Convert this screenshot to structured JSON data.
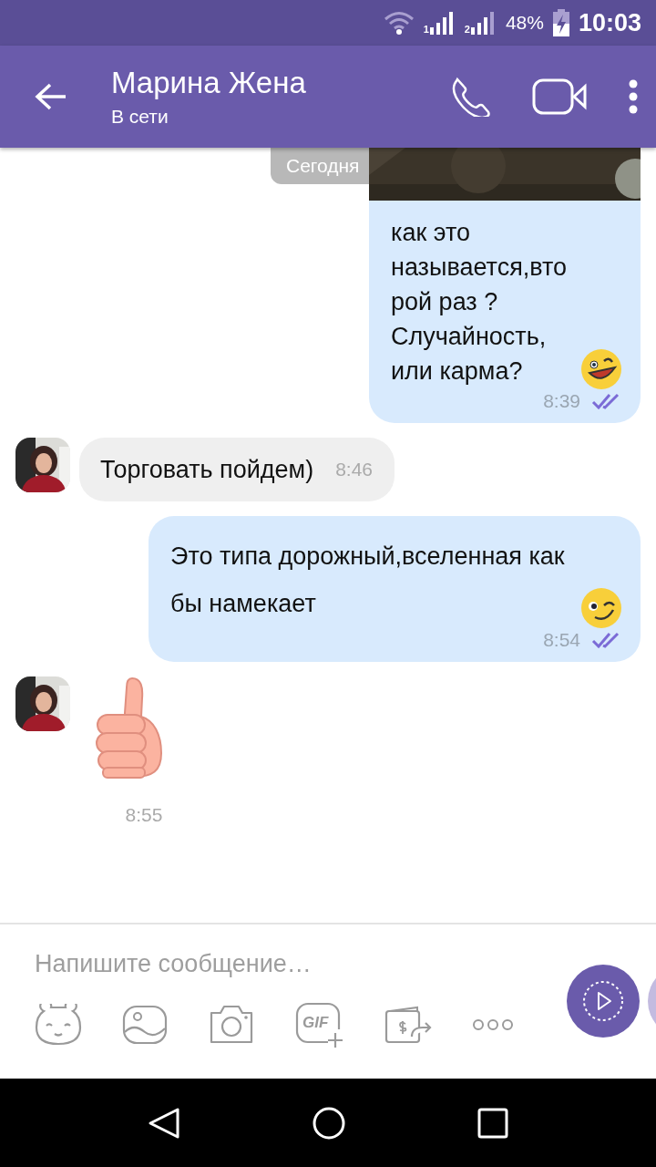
{
  "status_bar": {
    "sims": [
      {
        "label": "1"
      },
      {
        "label": "2"
      }
    ],
    "battery": "48%",
    "time": "10:03"
  },
  "header": {
    "title": "Марина Жена",
    "status": "В сети"
  },
  "date_chip": "Сегодня",
  "messages": [
    {
      "kind": "outgoing",
      "text": "как это называется,второй раз ? Случайность, или карма?",
      "emoji": {
        "kind": "grin"
      },
      "time": "8:39",
      "read": true
    },
    {
      "kind": "incoming",
      "text": "Торговать пойдем)",
      "time": "8:46"
    },
    {
      "kind": "outgoing",
      "text": "Это типа дорожный,вселенная как бы намекает",
      "emoji": {
        "kind": "wink"
      },
      "time": "8:54",
      "read": true
    },
    {
      "kind": "sticker",
      "time": "8:55"
    }
  ],
  "composer": {
    "placeholder": "Напишите сообщение…",
    "gif_label": "GIF"
  }
}
